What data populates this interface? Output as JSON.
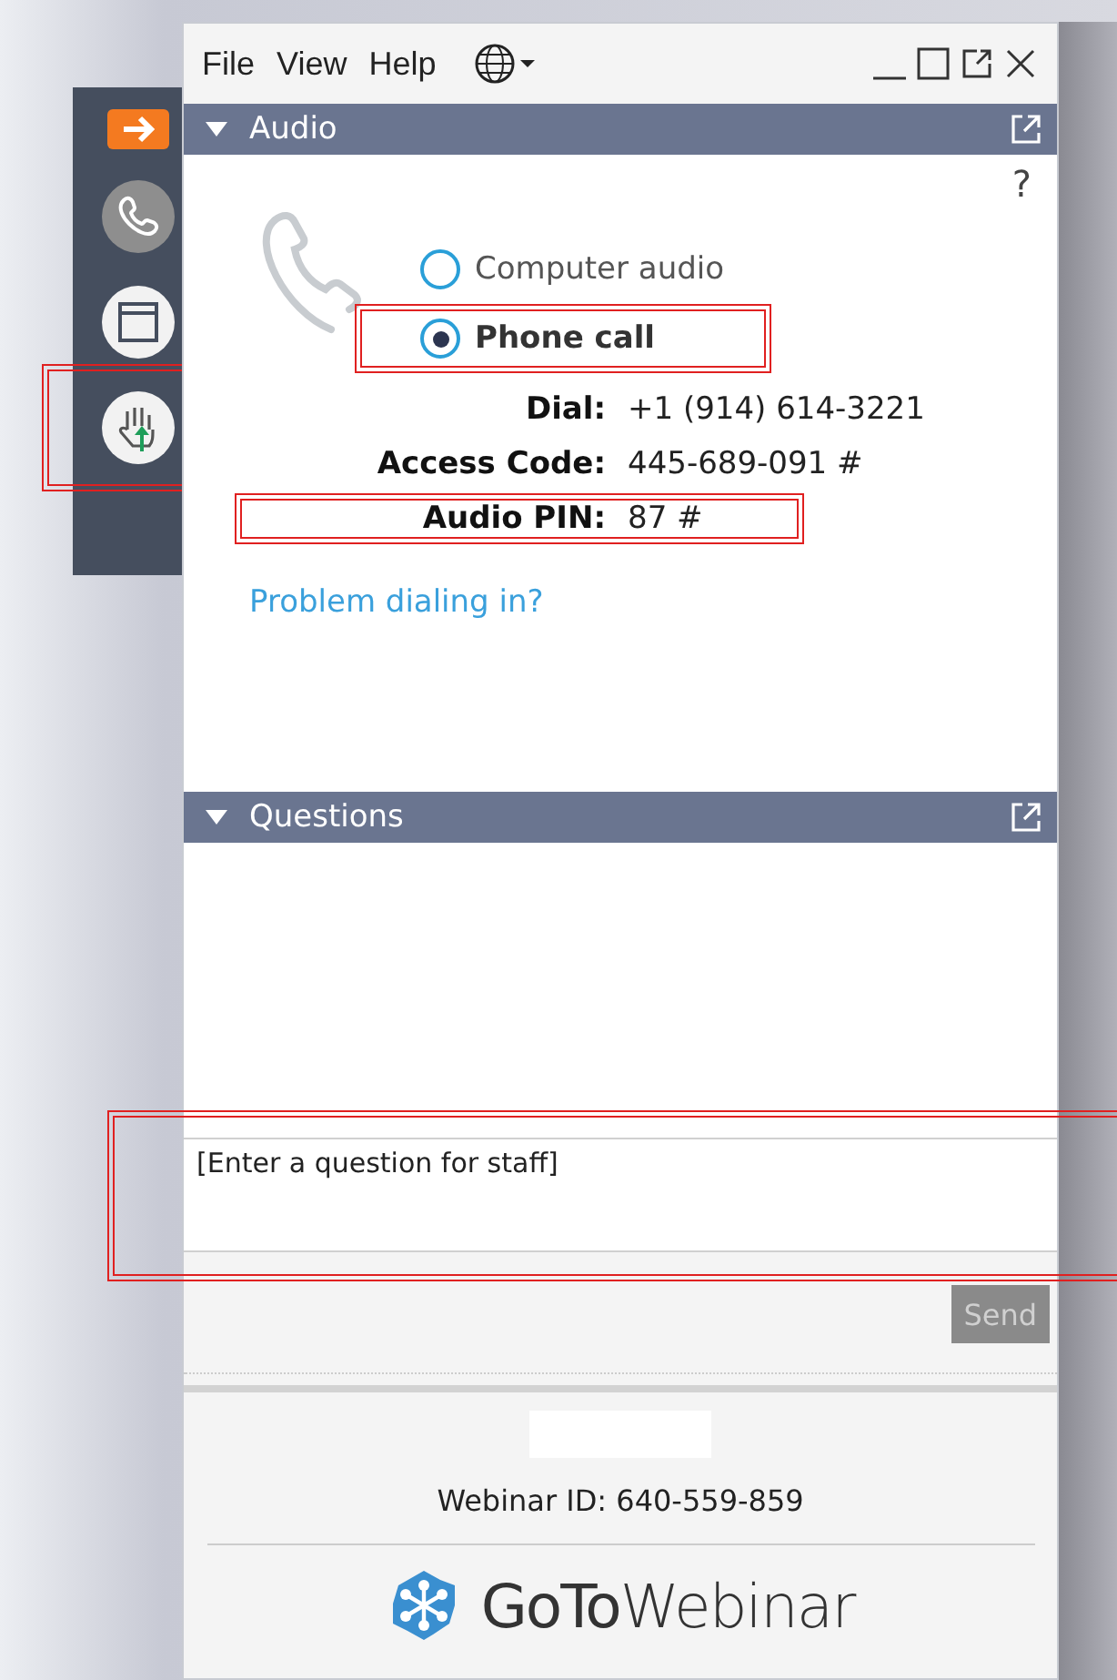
{
  "toolbar": {
    "items": [
      {
        "kind": "arrow",
        "highlighted": false
      },
      {
        "kind": "phone",
        "highlighted": false
      },
      {
        "kind": "window",
        "highlighted": false
      },
      {
        "kind": "hand",
        "highlighted": true
      }
    ]
  },
  "menu": [
    "File",
    "View",
    "Help"
  ],
  "audio": {
    "title": "Audio",
    "expanded": true,
    "help": "?",
    "options": [
      {
        "label": "Computer audio",
        "selected": false,
        "highlighted": false
      },
      {
        "label": "Phone call",
        "selected": true,
        "highlighted": true
      }
    ],
    "details": [
      {
        "label": "Dial:",
        "value": "+1 (914) 614-3221",
        "highlighted": false
      },
      {
        "label": "Access Code:",
        "value": "445-689-091 #",
        "highlighted": false
      },
      {
        "label": "Audio PIN:",
        "value": "87 #",
        "highlighted": true
      }
    ],
    "link": "Problem dialing in?"
  },
  "questions": {
    "title": "Questions",
    "expanded": true,
    "placeholder": "[Enter a question for staff]",
    "highlighted": true,
    "send": "Send",
    "send_disabled": true
  },
  "footer": {
    "webinar_id": "Webinar ID: 640-559-859",
    "logo": "**GoTo**Webinar"
  }
}
